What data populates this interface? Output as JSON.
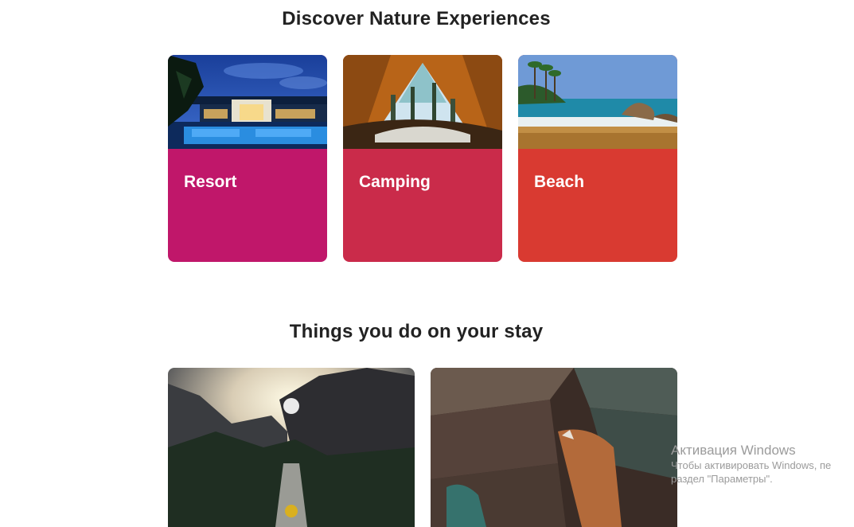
{
  "section1": {
    "title": "Discover Nature Experiences"
  },
  "cards": [
    {
      "label": "Resort",
      "image": "resort-pool-photo",
      "color": "#c0176a"
    },
    {
      "label": "Camping",
      "image": "tent-view-photo",
      "color": "#ca2b4a"
    },
    {
      "label": "Beach",
      "image": "tropical-beach-photo",
      "color": "#d93a31"
    }
  ],
  "section2": {
    "title": "Things you do on your stay"
  },
  "activities": [
    {
      "image": "mountain-bridge-hiking-photo"
    },
    {
      "image": "rock-climbing-photo"
    }
  ],
  "watermark": {
    "title": "Активация Windows",
    "line1": "Чтобы активировать Windows, пе",
    "line2": "раздел \"Параметры\"."
  }
}
